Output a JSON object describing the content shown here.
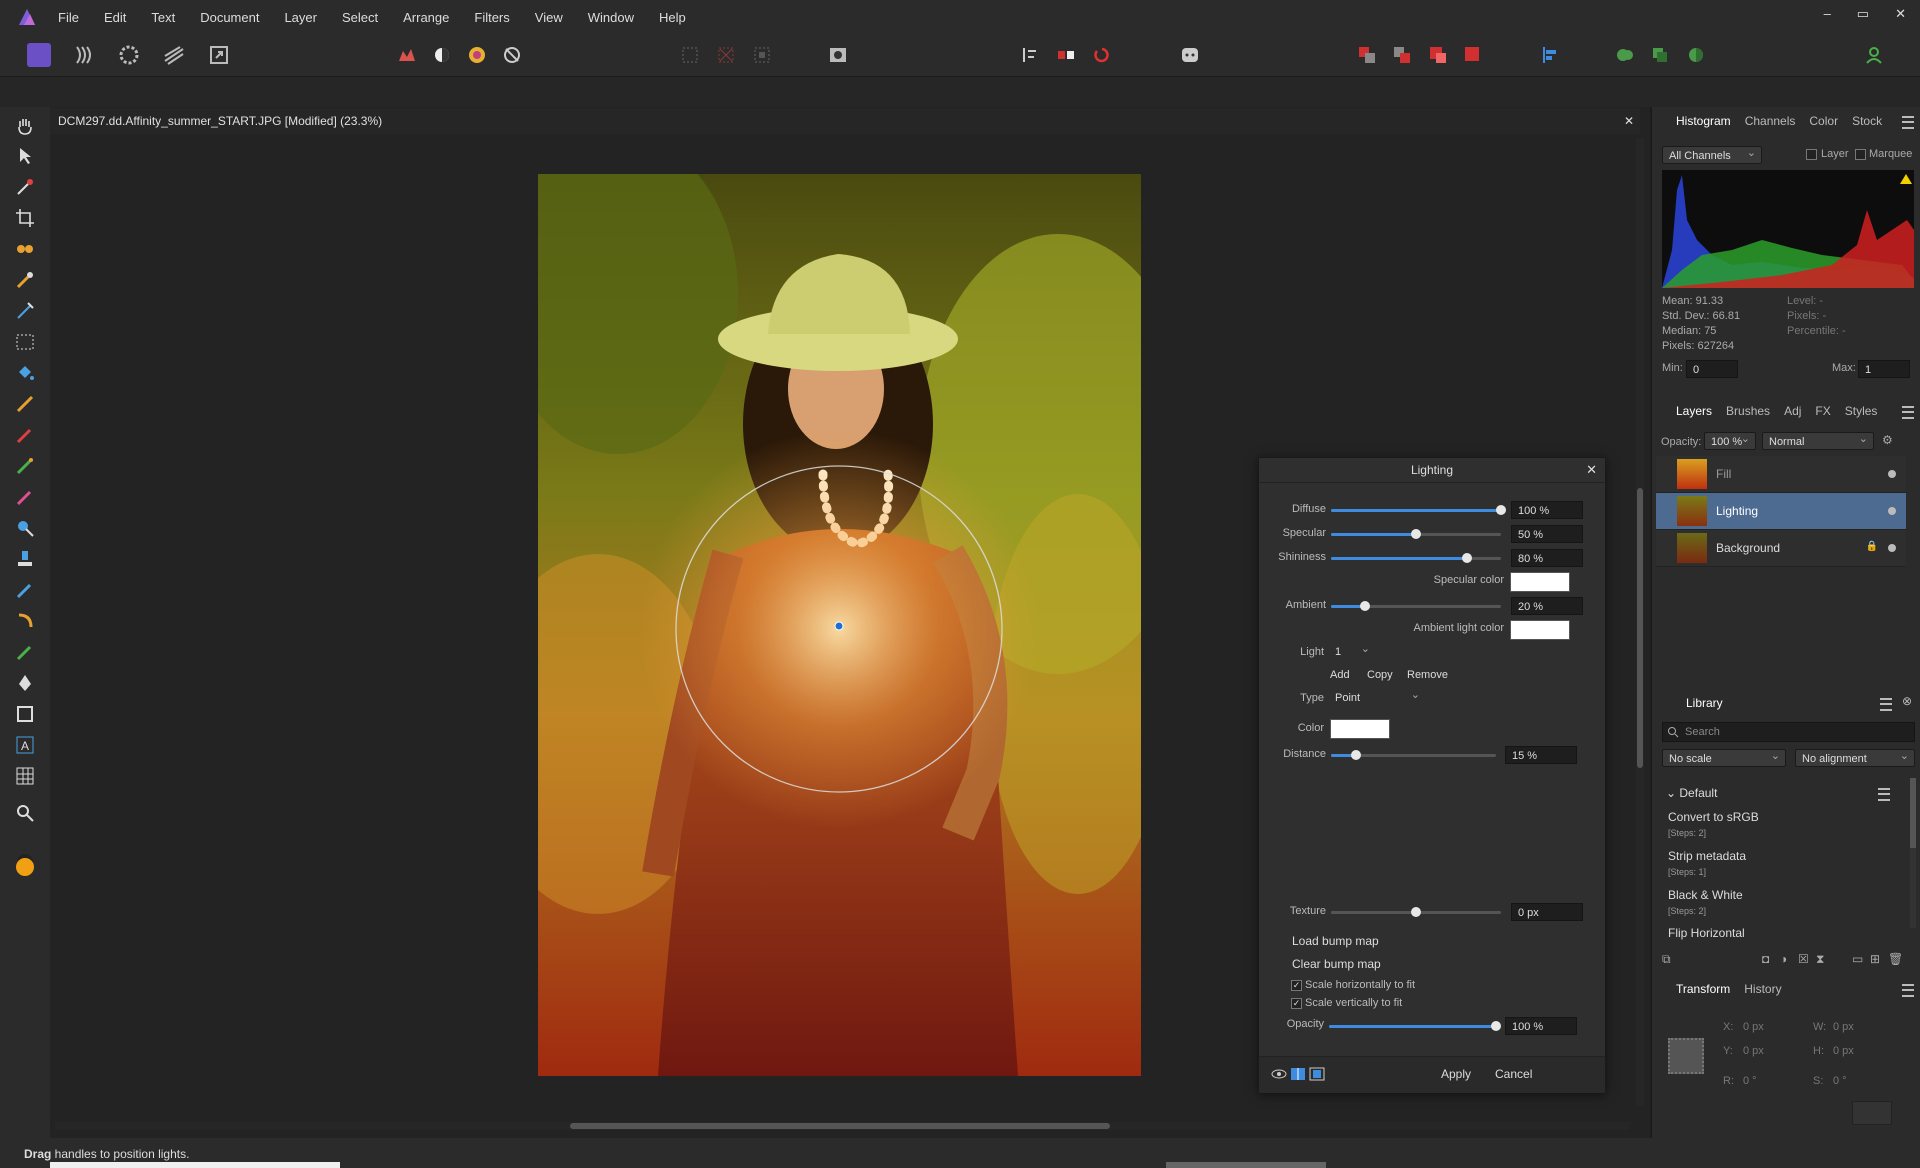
{
  "menubar": {
    "items": [
      "File",
      "Edit",
      "Text",
      "Document",
      "Layer",
      "Select",
      "Arrange",
      "Filters",
      "View",
      "Window",
      "Help"
    ],
    "window_controls": [
      "–",
      "▭",
      "✕"
    ]
  },
  "document": {
    "title": "DCM297.dd.Affinity_summer_START.JPG [Modified] (23.3%)",
    "close": "✕"
  },
  "status": {
    "bold": "Drag",
    "text": " handles to position lights."
  },
  "histogram": {
    "tabs": [
      "Histogram",
      "Channels",
      "Color",
      "Stock"
    ],
    "channel": "All Channels",
    "layer_label": "Layer",
    "marquee_label": "Marquee",
    "stats": [
      "Mean: 91.33",
      "Std. Dev.: 66.81",
      "Median: 75",
      "Pixels: 627264"
    ],
    "stats_right": [
      "Level: -",
      "Pixels: -",
      "Percentile: -"
    ],
    "min_label": "Min:",
    "min_value": "0",
    "max_label": "Max:",
    "max_value": "1"
  },
  "layers": {
    "tabs": [
      "Layers",
      "Brushes",
      "Adj",
      "FX",
      "Styles"
    ],
    "opacity_label": "Opacity:",
    "opacity_value": "100 %",
    "blend": "Normal",
    "items": [
      {
        "name": "Fill"
      },
      {
        "name": "Lighting"
      },
      {
        "name": "Background"
      }
    ]
  },
  "library": {
    "tab": "Library",
    "search_placeholder": "Search",
    "scale": "No scale",
    "alignment": "No alignment",
    "group": "Default",
    "items": [
      {
        "title": "Convert to sRGB",
        "steps": "[Steps: 2]"
      },
      {
        "title": "Strip metadata",
        "steps": "[Steps: 1]"
      },
      {
        "title": "Black & White",
        "steps": "[Steps: 2]"
      },
      {
        "title": "Flip Horizontal",
        "steps": ""
      }
    ]
  },
  "transform": {
    "tabs": [
      "Transform",
      "History"
    ],
    "x_label": "X:",
    "x": "0 px",
    "w_label": "W:",
    "w": "0 px",
    "y_label": "Y:",
    "y": "0 px",
    "h_label": "H:",
    "h": "0 px",
    "r_label": "R:",
    "r": "0 °",
    "s_label": "S:",
    "s": "0 °"
  },
  "lighting": {
    "title": "Lighting",
    "diffuse_label": "Diffuse",
    "diffuse": "100 %",
    "diffuse_level": 1.0,
    "specular_label": "Specular",
    "specular": "50 %",
    "specular_level": 0.5,
    "shininess_label": "Shininess",
    "shininess": "80 %",
    "shininess_level": 0.8,
    "specular_color_label": "Specular color",
    "ambient_label": "Ambient",
    "ambient": "20 %",
    "ambient_level": 0.2,
    "ambient_color_label": "Ambient light color",
    "light_label": "Light",
    "light_value": "1",
    "add": "Add",
    "copy": "Copy",
    "remove": "Remove",
    "type_label": "Type",
    "type_value": "Point",
    "color_label": "Color",
    "distance_label": "Distance",
    "distance": "15 %",
    "distance_level": 0.15,
    "texture_label": "Texture",
    "texture": "0 px",
    "texture_level": 0.5,
    "load_bump": "Load bump map",
    "clear_bump": "Clear bump map",
    "scale_h": "Scale horizontally to fit",
    "scale_v": "Scale vertically to fit",
    "opacity_label": "Opacity",
    "opacity": "100 %",
    "opacity_level": 1.0,
    "apply": "Apply",
    "cancel": "Cancel"
  },
  "colors": {
    "accent": "#3f8be0",
    "selected_layer": "#4d6a91",
    "panel": "#2b2b2b"
  }
}
